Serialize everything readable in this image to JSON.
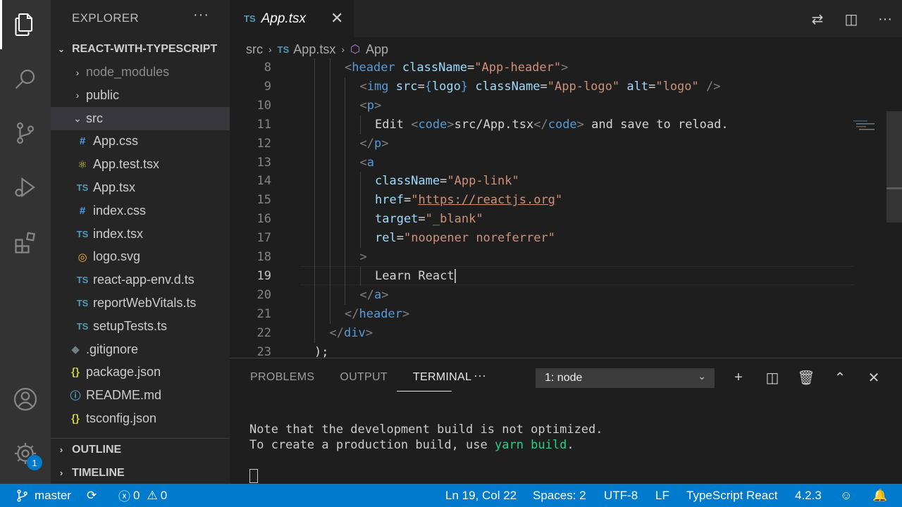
{
  "sidebar": {
    "title": "EXPLORER",
    "more": "···",
    "project": "REACT-WITH-TYPESCRIPT",
    "items": [
      {
        "label": "node_modules",
        "icon": "›",
        "kind": "folder-closed"
      },
      {
        "label": "public",
        "icon": "›",
        "kind": "folder-closed"
      },
      {
        "label": "src",
        "icon": "⌄",
        "kind": "folder-open"
      },
      {
        "label": "App.css",
        "icon": "#",
        "kind": "css"
      },
      {
        "label": "App.test.tsx",
        "icon": "⚛",
        "kind": "test"
      },
      {
        "label": "App.tsx",
        "icon": "TS",
        "kind": "ts"
      },
      {
        "label": "index.css",
        "icon": "#",
        "kind": "css"
      },
      {
        "label": "index.tsx",
        "icon": "TS",
        "kind": "ts"
      },
      {
        "label": "logo.svg",
        "icon": "◎",
        "kind": "svg"
      },
      {
        "label": "react-app-env.d.ts",
        "icon": "TS",
        "kind": "ts"
      },
      {
        "label": "reportWebVitals.ts",
        "icon": "TS",
        "kind": "ts"
      },
      {
        "label": "setupTests.ts",
        "icon": "TS",
        "kind": "ts"
      },
      {
        "label": ".gitignore",
        "icon": "◆",
        "kind": "git"
      },
      {
        "label": "package.json",
        "icon": "{}",
        "kind": "json"
      },
      {
        "label": "README.md",
        "icon": "ⓘ",
        "kind": "md"
      },
      {
        "label": "tsconfig.json",
        "icon": "{}",
        "kind": "json"
      }
    ],
    "outline": "OUTLINE",
    "timeline": "TIMELINE"
  },
  "activity": {
    "settings_badge": "1"
  },
  "editor": {
    "tab": {
      "icon": "TS",
      "name": "App.tsx"
    },
    "breadcrumb": {
      "folder": "src",
      "file_icon": "TS",
      "file": "App.tsx",
      "symbol": "App"
    },
    "lines": [
      {
        "n": "8",
        "indent": 4,
        "segs": [
          [
            "t-br",
            "<"
          ],
          [
            "t-tag",
            "header"
          ],
          [
            "t-tx",
            " "
          ],
          [
            "t-at",
            "className"
          ],
          [
            "t-tx",
            "="
          ],
          [
            "t-st",
            "\"App-header\""
          ],
          [
            "t-br",
            ">"
          ]
        ]
      },
      {
        "n": "9",
        "indent": 6,
        "segs": [
          [
            "t-br",
            "<"
          ],
          [
            "t-tag",
            "img"
          ],
          [
            "t-tx",
            " "
          ],
          [
            "t-at",
            "src"
          ],
          [
            "t-tx",
            "="
          ],
          [
            "t-tag",
            "{"
          ],
          [
            "t-at",
            "logo"
          ],
          [
            "t-tag",
            "}"
          ],
          [
            "t-tx",
            " "
          ],
          [
            "t-at",
            "className"
          ],
          [
            "t-tx",
            "="
          ],
          [
            "t-st",
            "\"App-logo\""
          ],
          [
            "t-tx",
            " "
          ],
          [
            "t-at",
            "alt"
          ],
          [
            "t-tx",
            "="
          ],
          [
            "t-st",
            "\"logo\""
          ],
          [
            "t-tx",
            " "
          ],
          [
            "t-br",
            "/>"
          ]
        ]
      },
      {
        "n": "10",
        "indent": 6,
        "segs": [
          [
            "t-br",
            "<"
          ],
          [
            "t-tag",
            "p"
          ],
          [
            "t-br",
            ">"
          ]
        ]
      },
      {
        "n": "11",
        "indent": 8,
        "segs": [
          [
            "t-tx",
            "Edit "
          ],
          [
            "t-br",
            "<"
          ],
          [
            "t-tag",
            "code"
          ],
          [
            "t-br",
            ">"
          ],
          [
            "t-tx",
            "src/App.tsx"
          ],
          [
            "t-br",
            "</"
          ],
          [
            "t-tag",
            "code"
          ],
          [
            "t-br",
            ">"
          ],
          [
            "t-tx",
            " and save to reload."
          ]
        ]
      },
      {
        "n": "12",
        "indent": 6,
        "segs": [
          [
            "t-br",
            "</"
          ],
          [
            "t-tag",
            "p"
          ],
          [
            "t-br",
            ">"
          ]
        ]
      },
      {
        "n": "13",
        "indent": 6,
        "segs": [
          [
            "t-br",
            "<"
          ],
          [
            "t-tag",
            "a"
          ]
        ]
      },
      {
        "n": "14",
        "indent": 8,
        "segs": [
          [
            "t-at",
            "className"
          ],
          [
            "t-tx",
            "="
          ],
          [
            "t-st",
            "\"App-link\""
          ]
        ]
      },
      {
        "n": "15",
        "indent": 8,
        "segs": [
          [
            "t-at",
            "href"
          ],
          [
            "t-tx",
            "="
          ],
          [
            "t-st",
            "\""
          ],
          [
            "t-ul",
            "https://reactjs.org"
          ],
          [
            "t-st",
            "\""
          ]
        ]
      },
      {
        "n": "16",
        "indent": 8,
        "segs": [
          [
            "t-at",
            "target"
          ],
          [
            "t-tx",
            "="
          ],
          [
            "t-st",
            "\"_blank\""
          ]
        ]
      },
      {
        "n": "17",
        "indent": 8,
        "segs": [
          [
            "t-at",
            "rel"
          ],
          [
            "t-tx",
            "="
          ],
          [
            "t-st",
            "\"noopener noreferrer\""
          ]
        ]
      },
      {
        "n": "18",
        "indent": 6,
        "segs": [
          [
            "t-br",
            ">"
          ]
        ]
      },
      {
        "n": "19",
        "indent": 8,
        "segs": [
          [
            "t-tx",
            "Learn React"
          ]
        ]
      },
      {
        "n": "20",
        "indent": 6,
        "segs": [
          [
            "t-br",
            "</"
          ],
          [
            "t-tag",
            "a"
          ],
          [
            "t-br",
            ">"
          ]
        ]
      },
      {
        "n": "21",
        "indent": 4,
        "segs": [
          [
            "t-br",
            "</"
          ],
          [
            "t-tag",
            "header"
          ],
          [
            "t-br",
            ">"
          ]
        ]
      },
      {
        "n": "22",
        "indent": 2,
        "segs": [
          [
            "t-br",
            "</"
          ],
          [
            "t-tag",
            "div"
          ],
          [
            "t-br",
            ">"
          ]
        ]
      },
      {
        "n": "23",
        "indent": 0,
        "segs": [
          [
            "t-tx",
            ");"
          ]
        ]
      }
    ],
    "current_line": "19"
  },
  "panel": {
    "tabs": [
      "PROBLEMS",
      "OUTPUT",
      "TERMINAL"
    ],
    "active_tab": "TERMINAL",
    "more": "···",
    "terminal_select": "1: node",
    "terminal_lines": [
      {
        "segs": [
          [
            "",
            "Note that the development build is not optimized."
          ]
        ]
      },
      {
        "segs": [
          [
            "",
            "To create a production build, use "
          ],
          [
            "t-green",
            "yarn build"
          ],
          [
            "",
            "."
          ]
        ]
      }
    ]
  },
  "status": {
    "branch": "master",
    "errors": "0",
    "warnings": "0",
    "position": "Ln 19, Col 22",
    "spaces": "Spaces: 2",
    "encoding": "UTF-8",
    "eol": "LF",
    "language": "TypeScript React",
    "version": "4.2.3"
  },
  "colors": {
    "accent": "#007acc",
    "ts": "#519aba",
    "css": "#42a5f5",
    "json": "#cbcb41",
    "git": "#6d8086",
    "md": "#519aba",
    "svg": "#ffb13b",
    "test": "#cbcb41"
  }
}
